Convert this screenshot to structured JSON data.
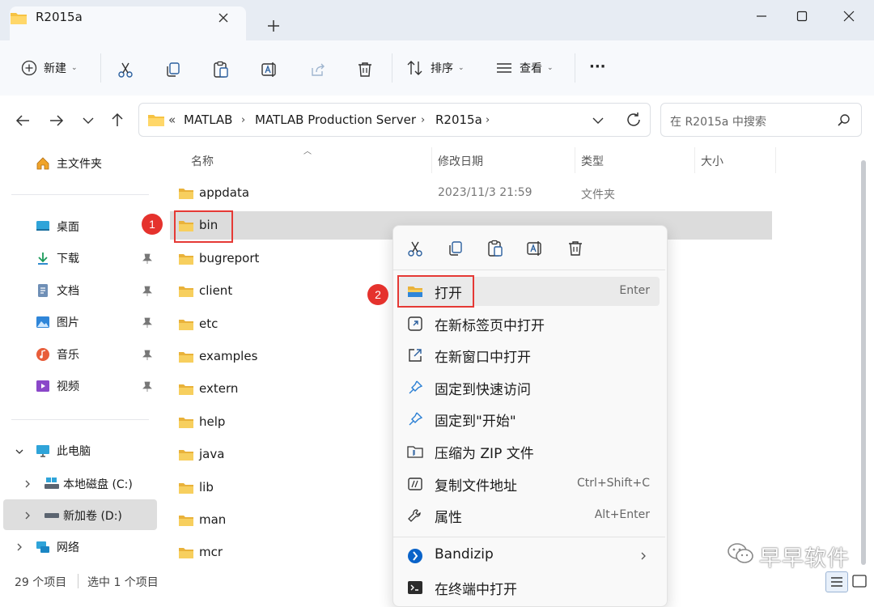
{
  "window": {
    "tab_title": "R2015a",
    "new_tab_symbol": "+",
    "controls": [
      "minimize",
      "maximize",
      "close"
    ]
  },
  "toolbar": {
    "new_label": "新建",
    "sort_label": "排序",
    "view_label": "查看",
    "more_label": "···",
    "icons": [
      "cut-icon",
      "copy-icon",
      "paste-icon",
      "rename-icon",
      "share-icon",
      "delete-icon"
    ]
  },
  "address": {
    "overflow": "«",
    "crumbs": [
      "MATLAB",
      "MATLAB Production Server",
      "R2015a"
    ],
    "search_placeholder": "在 R2015a 中搜索"
  },
  "nav": {
    "home": "主文件夹",
    "quick": [
      {
        "label": "桌面",
        "icon": "desktop-icon",
        "pinned": true
      },
      {
        "label": "下载",
        "icon": "download-icon",
        "pinned": true
      },
      {
        "label": "文档",
        "icon": "documents-icon",
        "pinned": true
      },
      {
        "label": "图片",
        "icon": "pictures-icon",
        "pinned": true
      },
      {
        "label": "音乐",
        "icon": "music-icon",
        "pinned": true
      },
      {
        "label": "视频",
        "icon": "video-icon",
        "pinned": true
      }
    ],
    "this_pc": "此电脑",
    "drives": [
      "本地磁盘 (C:)",
      "新加卷 (D:)"
    ],
    "network": "网络"
  },
  "columns": {
    "name": "名称",
    "date": "修改日期",
    "type": "类型",
    "size": "大小"
  },
  "files": [
    {
      "name": "appdata",
      "date": "2023/11/3 21:59",
      "type": "文件夹"
    },
    {
      "name": "bin",
      "date": "",
      "type": ""
    },
    {
      "name": "bugreport",
      "date": "",
      "type": ""
    },
    {
      "name": "client",
      "date": "",
      "type": ""
    },
    {
      "name": "etc",
      "date": "",
      "type": ""
    },
    {
      "name": "examples",
      "date": "",
      "type": ""
    },
    {
      "name": "extern",
      "date": "",
      "type": ""
    },
    {
      "name": "help",
      "date": "",
      "type": ""
    },
    {
      "name": "java",
      "date": "",
      "type": ""
    },
    {
      "name": "lib",
      "date": "",
      "type": ""
    },
    {
      "name": "man",
      "date": "",
      "type": ""
    },
    {
      "name": "mcr",
      "date": "",
      "type": ""
    }
  ],
  "status": {
    "count": "29 个项目",
    "selected": "选中 1 个项目"
  },
  "context_menu": {
    "quick_actions": [
      "cut-icon",
      "copy-icon",
      "paste-icon",
      "rename-icon",
      "delete-icon"
    ],
    "items": [
      {
        "label": "打开",
        "shortcut": "Enter",
        "icon": "folder-open-icon"
      },
      {
        "label": "在新标签页中打开",
        "shortcut": "",
        "icon": "new-tab-icon"
      },
      {
        "label": "在新窗口中打开",
        "shortcut": "",
        "icon": "new-window-icon"
      },
      {
        "label": "固定到快速访问",
        "shortcut": "",
        "icon": "pin-icon"
      },
      {
        "label": "固定到\"开始\"",
        "shortcut": "",
        "icon": "pin-start-icon"
      },
      {
        "label": "压缩为 ZIP 文件",
        "shortcut": "",
        "icon": "zip-icon"
      },
      {
        "label": "复制文件地址",
        "shortcut": "Ctrl+Shift+C",
        "icon": "copy-path-icon"
      },
      {
        "label": "属性",
        "shortcut": "Alt+Enter",
        "icon": "properties-icon"
      }
    ],
    "submenu_items": [
      {
        "label": "Bandizip",
        "icon": "bandizip-icon"
      },
      {
        "label": "在终端中打开",
        "icon": "terminal-icon"
      }
    ]
  },
  "annotations": {
    "step1": "1",
    "step2": "2"
  },
  "watermark": "早早软件",
  "colors": {
    "folder_yellow": "#f6c343",
    "selection": "#dcdcdc",
    "annotation_red": "#e53935",
    "accent_blue": "#0a63c9"
  }
}
